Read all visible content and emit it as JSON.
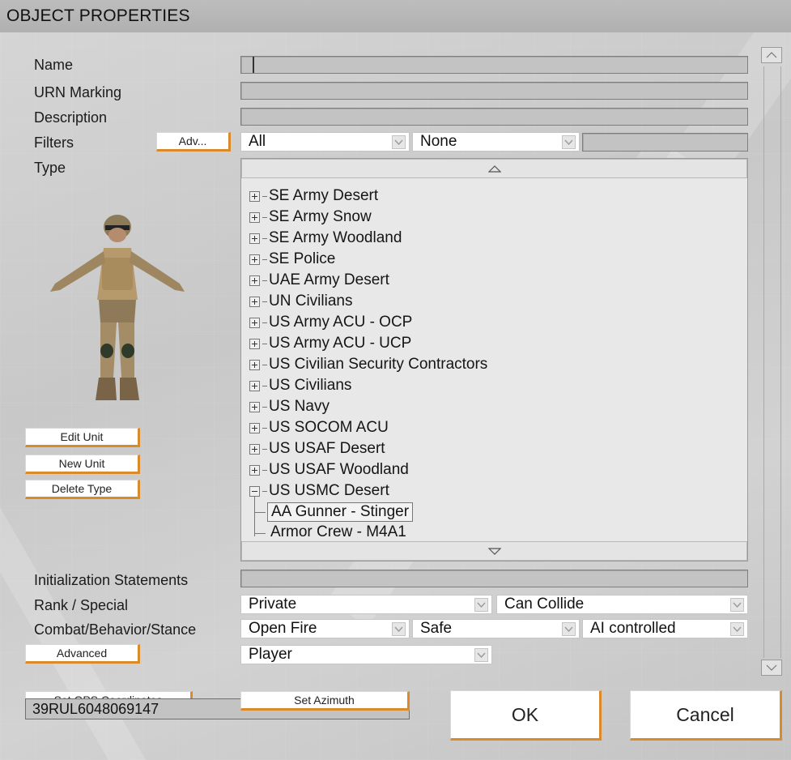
{
  "window": {
    "title": "OBJECT PROPERTIES"
  },
  "fields": {
    "name_label": "Name",
    "urn_label": "URN Marking",
    "description_label": "Description",
    "filters_label": "Filters",
    "type_label": "Type",
    "init_label": "Initialization Statements",
    "rank_label": "Rank / Special",
    "combat_label": "Combat/Behavior/Stance",
    "name_value": "",
    "urn_value": "",
    "description_value": "",
    "init_value": ""
  },
  "filters": {
    "adv_button": "Adv...",
    "category": "All",
    "subcategory": "None",
    "search_value": ""
  },
  "tree": {
    "items": [
      "SE Army Desert",
      "SE Army Snow",
      "SE Army Woodland",
      "SE Police",
      "UAE Army Desert",
      "UN Civilians",
      "US Army ACU - OCP",
      "US Army ACU - UCP",
      "US Civilian Security Contractors",
      "US Civilians",
      "US Navy",
      "US SOCOM ACU",
      "US USAF Desert",
      "US USAF Woodland",
      "US USMC Desert"
    ],
    "expanded_item": "US USMC Desert",
    "children": [
      "AA Gunner - Stinger",
      "Armor Crew - M4A1"
    ],
    "selected_child": "AA Gunner - Stinger"
  },
  "unit_buttons": {
    "edit": "Edit Unit",
    "new": "New Unit",
    "delete": "Delete Type"
  },
  "rank": {
    "value": "Private",
    "special": "Can Collide"
  },
  "combat": {
    "fire": "Open Fire",
    "behavior": "Safe",
    "control": "AI controlled"
  },
  "advanced": {
    "button": "Advanced",
    "role": "Player"
  },
  "footer": {
    "gps_button": "Set GPS Coordinates",
    "azimuth_button": "Set Azimuth",
    "coordinates": "39RUL6048069147",
    "ok": "OK",
    "cancel": "Cancel"
  },
  "colors": {
    "button_accent": "#d98a2b",
    "panel_bg": "#cfcfcf",
    "field_bg": "#c3c3c3"
  },
  "icons": {
    "expand": "plus-box-icon",
    "collapse": "minus-box-icon",
    "dropdown": "chevron-down-icon",
    "scroll_up": "triangle-up-icon",
    "scroll_down": "triangle-down-icon"
  }
}
